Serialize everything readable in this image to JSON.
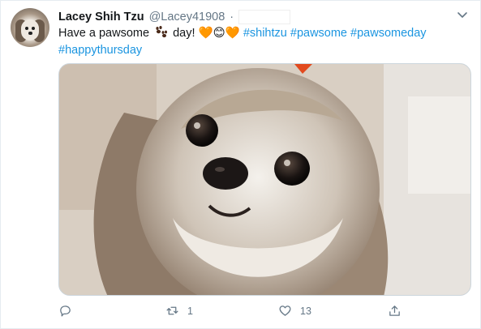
{
  "tweet": {
    "author_name": "Lacey Shih Tzu",
    "author_handle": "@Lacey41908",
    "separator": "·",
    "text_prefix": "Have a pawsome",
    "text_day": "day!",
    "emoji": [
      "🧡",
      "😊",
      "🧡"
    ],
    "hashtags": [
      "#shihtzu",
      "#pawsome",
      "#pawsomeday",
      "#happythursday"
    ]
  },
  "actions": {
    "reply_count": "",
    "retweet_count": "1",
    "like_count": "13"
  },
  "icons": {
    "avatar": "avatar-icon",
    "more": "chevron-down-icon",
    "paw": "paw-prints-icon",
    "reply": "reply-icon",
    "retweet": "retweet-icon",
    "like": "heart-icon",
    "share": "share-icon"
  },
  "colors": {
    "link": "#1b95e0",
    "muted": "#657786",
    "text": "#14171a"
  }
}
